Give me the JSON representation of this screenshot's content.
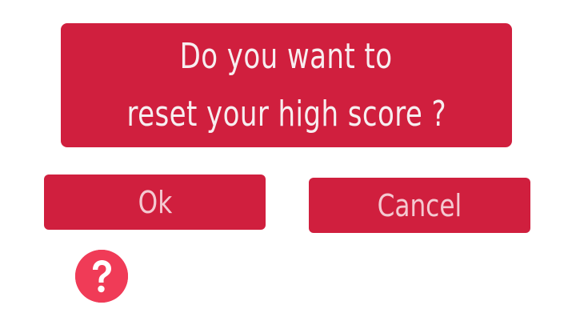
{
  "dialog": {
    "message_line1": "Do you want to",
    "message_line2": "reset your high score ?"
  },
  "buttons": {
    "ok_label": "Ok",
    "cancel_label": "Cancel"
  },
  "help": {
    "icon": "question-mark-icon"
  },
  "colors": {
    "panel": "#d01f3e",
    "button": "#d01f3e",
    "help_circle": "#f03b57",
    "text": "#f7eef0",
    "button_text": "#f4c9d1"
  }
}
